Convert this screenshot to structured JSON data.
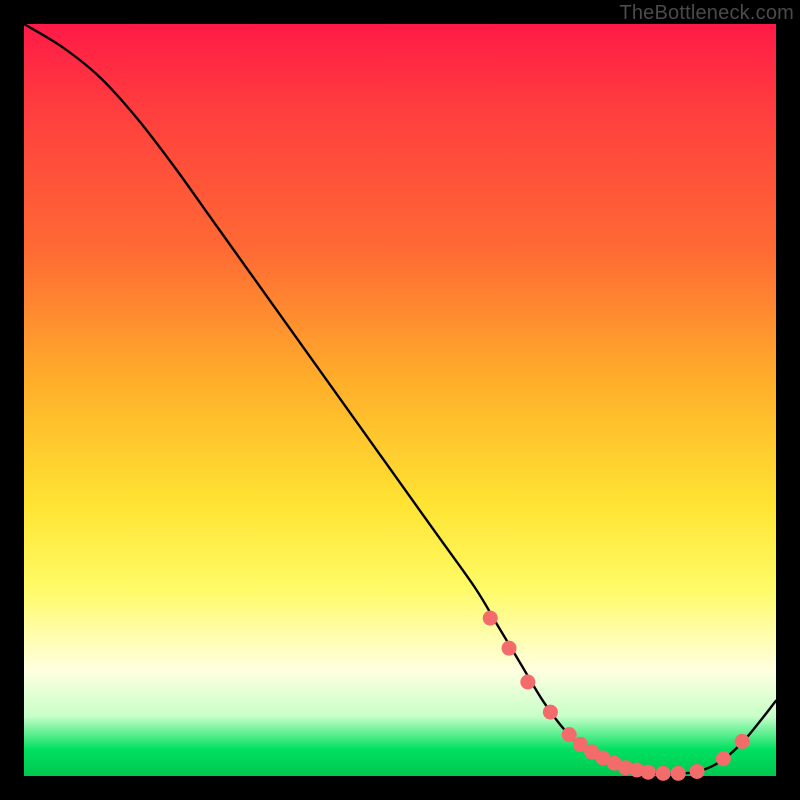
{
  "watermark": "TheBottleneck.com",
  "colors": {
    "dot": "#f46b6b",
    "curve": "#000000"
  },
  "chart_data": {
    "type": "line",
    "title": "",
    "xlabel": "",
    "ylabel": "",
    "xlim": [
      0,
      100
    ],
    "ylim": [
      0,
      100
    ],
    "grid": false,
    "series": [
      {
        "name": "bottleneck-curve",
        "x": [
          0,
          5,
          10,
          15,
          20,
          25,
          30,
          35,
          40,
          45,
          50,
          55,
          60,
          63,
          66,
          69,
          72,
          75,
          78,
          81,
          84,
          87,
          90,
          93,
          96,
          100
        ],
        "y": [
          100,
          97,
          93,
          87.5,
          81,
          74,
          67,
          60,
          53,
          46,
          39,
          32,
          25,
          20,
          15,
          10,
          6,
          3.2,
          1.6,
          0.7,
          0.3,
          0.3,
          0.7,
          2.2,
          5.0,
          10
        ]
      }
    ],
    "dots": {
      "name": "highlighted-points",
      "x": [
        62,
        64.5,
        67,
        70,
        72.5,
        74,
        75.5,
        77,
        78.5,
        80,
        81.5,
        83,
        85,
        87,
        89.5,
        93,
        95.5
      ],
      "y": [
        21,
        17,
        12.5,
        8.5,
        5.5,
        4.2,
        3.2,
        2.4,
        1.7,
        1.1,
        0.8,
        0.5,
        0.35,
        0.35,
        0.6,
        2.3,
        4.6
      ]
    }
  }
}
